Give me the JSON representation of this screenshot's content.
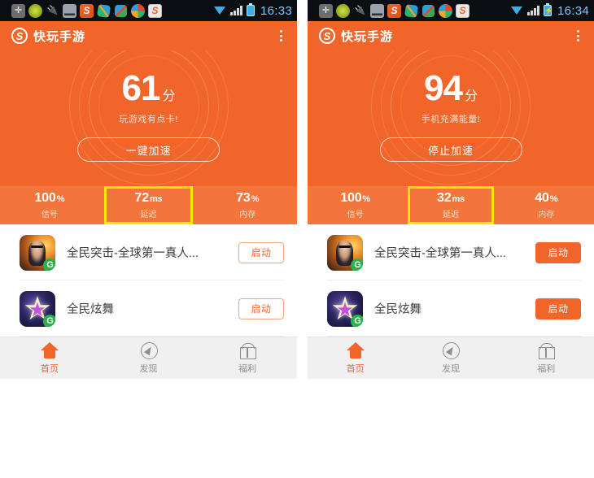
{
  "panels": [
    {
      "statusbar": {
        "time": "16:33",
        "icons": [
          "plus-icon",
          "green-dot-icon",
          "usb-icon",
          "picture-icon",
          "sogou-icon",
          "swirl-green-icon",
          "swirl-red-icon",
          "colorball-icon",
          "sogou-light-icon"
        ],
        "wifi": "wifi-icon",
        "signal": "signal-icon",
        "battery": "battery-icon",
        "battery_charging": false
      },
      "appbar": {
        "title": "快玩手游",
        "logo": "swirl-logo-icon",
        "menu": "overflow-menu-icon"
      },
      "hero": {
        "score": "61",
        "score_unit": "分",
        "subtitle": "玩游戏有点卡!",
        "button_label": "一键加速"
      },
      "stats": [
        {
          "value": "100",
          "unit": "%",
          "label": "信号",
          "highlighted": false
        },
        {
          "value": "72",
          "unit": "ms",
          "label": "延迟",
          "highlighted": true
        },
        {
          "value": "73",
          "unit": "%",
          "label": "内存",
          "highlighted": false
        }
      ],
      "games": [
        {
          "name": "全民突击-全球第一真人...",
          "icon": "game-icon-shooter",
          "button": "启动",
          "style": "outline"
        },
        {
          "name": "全民炫舞",
          "icon": "game-icon-dance",
          "button": "启动",
          "style": "outline"
        }
      ],
      "tabs": [
        {
          "label": "首页",
          "icon": "home-icon",
          "active": true
        },
        {
          "label": "发现",
          "icon": "compass-icon",
          "active": false
        },
        {
          "label": "福利",
          "icon": "gift-icon",
          "active": false
        }
      ]
    },
    {
      "statusbar": {
        "time": "16:34",
        "icons": [
          "plus-icon",
          "green-dot-icon",
          "usb-icon",
          "picture-icon",
          "sogou-icon",
          "swirl-green-icon",
          "swirl-red-icon",
          "colorball-icon",
          "sogou-light-icon"
        ],
        "wifi": "wifi-icon",
        "signal": "signal-icon",
        "battery": "battery-charging-icon",
        "battery_charging": true
      },
      "appbar": {
        "title": "快玩手游",
        "logo": "swirl-logo-icon",
        "menu": "overflow-menu-icon"
      },
      "hero": {
        "score": "94",
        "score_unit": "分",
        "subtitle": "手机充满能量!",
        "button_label": "停止加速"
      },
      "stats": [
        {
          "value": "100",
          "unit": "%",
          "label": "信号",
          "highlighted": false
        },
        {
          "value": "32",
          "unit": "ms",
          "label": "延迟",
          "highlighted": true
        },
        {
          "value": "40",
          "unit": "%",
          "label": "内存",
          "highlighted": false
        }
      ],
      "games": [
        {
          "name": "全民突击-全球第一真人...",
          "icon": "game-icon-shooter",
          "button": "启动",
          "style": "filled"
        },
        {
          "name": "全民炫舞",
          "icon": "game-icon-dance",
          "button": "启动",
          "style": "filled"
        }
      ],
      "tabs": [
        {
          "label": "首页",
          "icon": "home-icon",
          "active": true
        },
        {
          "label": "发现",
          "icon": "compass-icon",
          "active": false
        },
        {
          "label": "福利",
          "icon": "gift-icon",
          "active": false
        }
      ]
    }
  ],
  "colors": {
    "brand_orange": "#f2652a",
    "stats_orange": "#f4753b",
    "highlight_yellow": "#ffe800",
    "statusbar_black": "#0b0f14",
    "time_blue": "#7ec9f2",
    "tabbar_gray": "#f0f0f0"
  }
}
